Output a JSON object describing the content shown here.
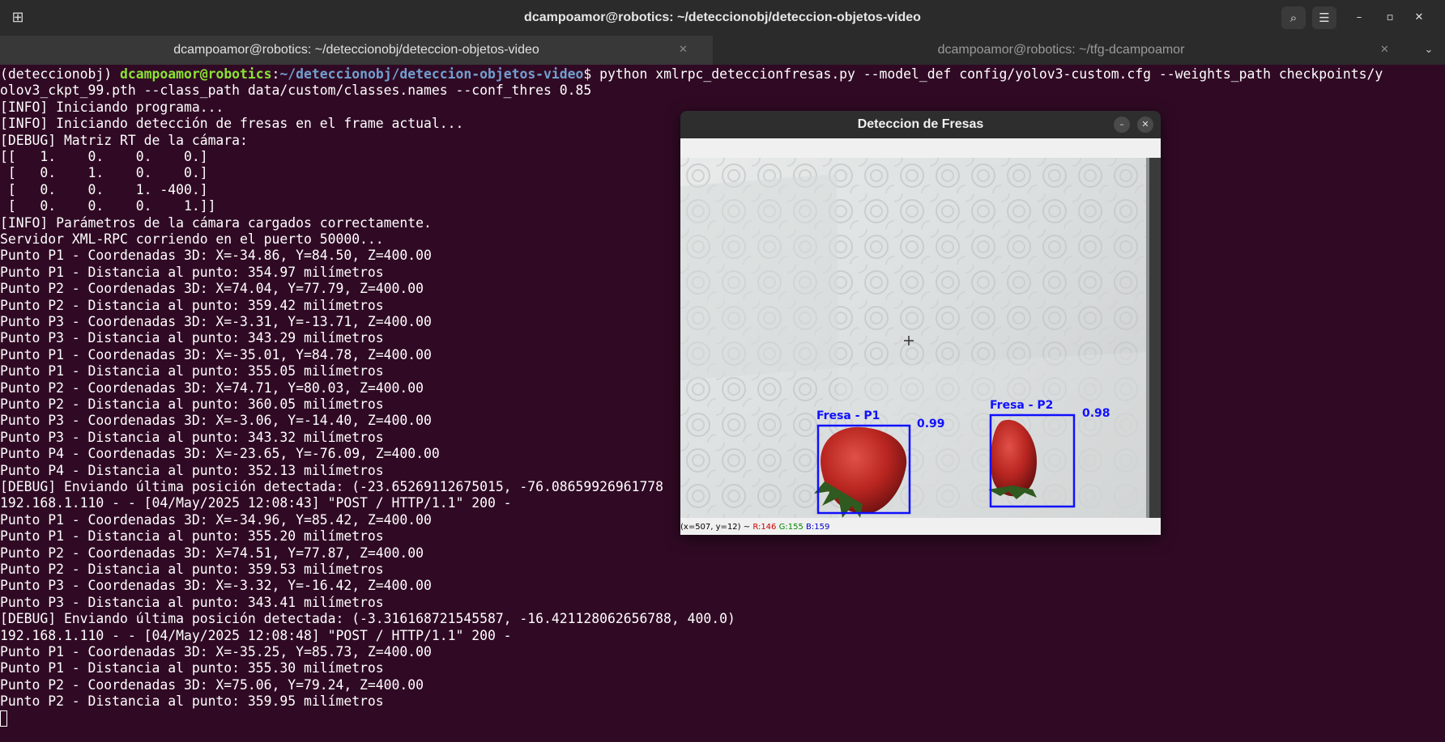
{
  "window": {
    "title": "dcampoamor@robotics: ~/deteccionobj/deteccion-objetos-video",
    "buttons": {
      "search": "⌕",
      "menu": "☰",
      "minimize": "–",
      "maximize": "▫",
      "close": "✕"
    }
  },
  "tabs": [
    {
      "label": "dcampoamor@robotics: ~/deteccionobj/deteccion-objetos-video",
      "active": true
    },
    {
      "label": "dcampoamor@robotics: ~/tfg-dcampoamor",
      "active": false
    }
  ],
  "terminal": {
    "prompt": {
      "env": "(deteccionobj) ",
      "user": "dcampoamor@robotics",
      "sep": ":",
      "path": "~/deteccionobj/deteccion-objetos-video",
      "dollar": "$ ",
      "command": "python xmlrpc_deteccionfresas.py --model_def config/yolov3-custom.cfg --weights_path checkpoints/y"
    },
    "lines": [
      "olov3_ckpt_99.pth --class_path data/custom/classes.names --conf_thres 0.85",
      "[INFO] Iniciando programa...",
      "[INFO] Iniciando detección de fresas en el frame actual...",
      "[DEBUG] Matriz RT de la cámara:",
      "[[   1.    0.    0.    0.]",
      " [   0.    1.    0.    0.]",
      " [   0.    0.    1. -400.]",
      " [   0.    0.    0.    1.]]",
      "[INFO] Parámetros de la cámara cargados correctamente.",
      "Servidor XML-RPC corriendo en el puerto 50000...",
      "Punto P1 - Coordenadas 3D: X=-34.86, Y=84.50, Z=400.00",
      "Punto P1 - Distancia al punto: 354.97 milímetros",
      "Punto P2 - Coordenadas 3D: X=74.04, Y=77.79, Z=400.00",
      "Punto P2 - Distancia al punto: 359.42 milímetros",
      "Punto P3 - Coordenadas 3D: X=-3.31, Y=-13.71, Z=400.00",
      "Punto P3 - Distancia al punto: 343.29 milímetros",
      "Punto P1 - Coordenadas 3D: X=-35.01, Y=84.78, Z=400.00",
      "Punto P1 - Distancia al punto: 355.05 milímetros",
      "Punto P2 - Coordenadas 3D: X=74.71, Y=80.03, Z=400.00",
      "Punto P2 - Distancia al punto: 360.05 milímetros",
      "Punto P3 - Coordenadas 3D: X=-3.06, Y=-14.40, Z=400.00",
      "Punto P3 - Distancia al punto: 343.32 milímetros",
      "Punto P4 - Coordenadas 3D: X=-23.65, Y=-76.09, Z=400.00",
      "Punto P4 - Distancia al punto: 352.13 milímetros",
      "[DEBUG] Enviando última posición detectada: (-23.65269112675015, -76.08659926961778",
      "192.168.1.110 - - [04/May/2025 12:08:43] \"POST / HTTP/1.1\" 200 -",
      "Punto P1 - Coordenadas 3D: X=-34.96, Y=85.42, Z=400.00",
      "Punto P1 - Distancia al punto: 355.20 milímetros",
      "Punto P2 - Coordenadas 3D: X=74.51, Y=77.87, Z=400.00",
      "Punto P2 - Distancia al punto: 359.53 milímetros",
      "Punto P3 - Coordenadas 3D: X=-3.32, Y=-16.42, Z=400.00",
      "Punto P3 - Distancia al punto: 343.41 milímetros",
      "[DEBUG] Enviando última posición detectada: (-3.316168721545587, -16.421128062656788, 400.0)",
      "192.168.1.110 - - [04/May/2025 12:08:48] \"POST / HTTP/1.1\" 200 -",
      "Punto P1 - Coordenadas 3D: X=-35.25, Y=85.73, Z=400.00",
      "Punto P1 - Distancia al punto: 355.30 milímetros",
      "Punto P2 - Coordenadas 3D: X=75.06, Y=79.24, Z=400.00",
      "Punto P2 - Distancia al punto: 359.95 milímetros"
    ]
  },
  "popup": {
    "title": "Deteccion de Fresas",
    "buttons": {
      "minimize": "–",
      "close": "✕"
    },
    "detections": [
      {
        "label": "Fresa - P1",
        "score": "0.99"
      },
      {
        "label": "Fresa - P2",
        "score": "0.98"
      }
    ],
    "status": {
      "coords": "(x=507, y=12) ~ ",
      "r": "R:146",
      "g": "G:155",
      "b": "B:159"
    },
    "colors": {
      "box": "#1010ff",
      "r": "#cc0000",
      "g": "#008800",
      "b": "#0000cc"
    }
  },
  "colors": {
    "background": "#300a24",
    "user": "#8ae234",
    "path": "#729fcf"
  }
}
